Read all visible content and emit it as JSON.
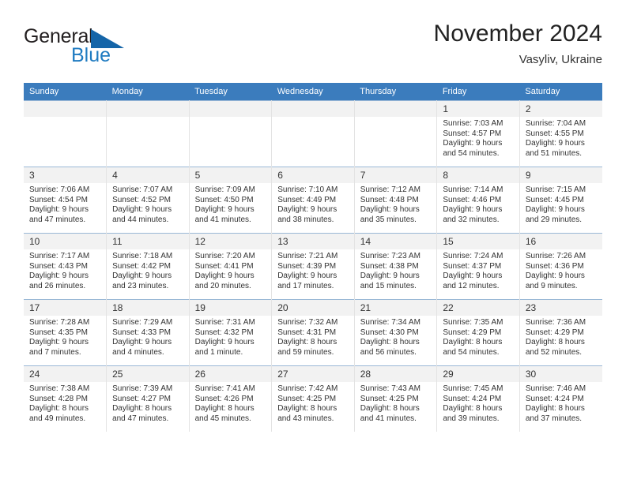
{
  "brand": {
    "name_part1": "General",
    "name_part2": "Blue",
    "logo_icon": "triangle-icon",
    "color_dark": "#231f20",
    "color_blue": "#1f7bc1"
  },
  "header": {
    "title": "November 2024",
    "subtitle": "Vasyliv, Ukraine"
  },
  "calendar": {
    "accent_color": "#3b7cbd",
    "daynum_background": "#f2f2f2",
    "weekday_headers": [
      "Sunday",
      "Monday",
      "Tuesday",
      "Wednesday",
      "Thursday",
      "Friday",
      "Saturday"
    ],
    "weeks": [
      [
        {
          "day": "",
          "empty": true
        },
        {
          "day": "",
          "empty": true
        },
        {
          "day": "",
          "empty": true
        },
        {
          "day": "",
          "empty": true
        },
        {
          "day": "",
          "empty": true
        },
        {
          "day": "1",
          "sunrise": "Sunrise: 7:03 AM",
          "sunset": "Sunset: 4:57 PM",
          "daylight": "Daylight: 9 hours and 54 minutes."
        },
        {
          "day": "2",
          "sunrise": "Sunrise: 7:04 AM",
          "sunset": "Sunset: 4:55 PM",
          "daylight": "Daylight: 9 hours and 51 minutes."
        }
      ],
      [
        {
          "day": "3",
          "sunrise": "Sunrise: 7:06 AM",
          "sunset": "Sunset: 4:54 PM",
          "daylight": "Daylight: 9 hours and 47 minutes."
        },
        {
          "day": "4",
          "sunrise": "Sunrise: 7:07 AM",
          "sunset": "Sunset: 4:52 PM",
          "daylight": "Daylight: 9 hours and 44 minutes."
        },
        {
          "day": "5",
          "sunrise": "Sunrise: 7:09 AM",
          "sunset": "Sunset: 4:50 PM",
          "daylight": "Daylight: 9 hours and 41 minutes."
        },
        {
          "day": "6",
          "sunrise": "Sunrise: 7:10 AM",
          "sunset": "Sunset: 4:49 PM",
          "daylight": "Daylight: 9 hours and 38 minutes."
        },
        {
          "day": "7",
          "sunrise": "Sunrise: 7:12 AM",
          "sunset": "Sunset: 4:48 PM",
          "daylight": "Daylight: 9 hours and 35 minutes."
        },
        {
          "day": "8",
          "sunrise": "Sunrise: 7:14 AM",
          "sunset": "Sunset: 4:46 PM",
          "daylight": "Daylight: 9 hours and 32 minutes."
        },
        {
          "day": "9",
          "sunrise": "Sunrise: 7:15 AM",
          "sunset": "Sunset: 4:45 PM",
          "daylight": "Daylight: 9 hours and 29 minutes."
        }
      ],
      [
        {
          "day": "10",
          "sunrise": "Sunrise: 7:17 AM",
          "sunset": "Sunset: 4:43 PM",
          "daylight": "Daylight: 9 hours and 26 minutes."
        },
        {
          "day": "11",
          "sunrise": "Sunrise: 7:18 AM",
          "sunset": "Sunset: 4:42 PM",
          "daylight": "Daylight: 9 hours and 23 minutes."
        },
        {
          "day": "12",
          "sunrise": "Sunrise: 7:20 AM",
          "sunset": "Sunset: 4:41 PM",
          "daylight": "Daylight: 9 hours and 20 minutes."
        },
        {
          "day": "13",
          "sunrise": "Sunrise: 7:21 AM",
          "sunset": "Sunset: 4:39 PM",
          "daylight": "Daylight: 9 hours and 17 minutes."
        },
        {
          "day": "14",
          "sunrise": "Sunrise: 7:23 AM",
          "sunset": "Sunset: 4:38 PM",
          "daylight": "Daylight: 9 hours and 15 minutes."
        },
        {
          "day": "15",
          "sunrise": "Sunrise: 7:24 AM",
          "sunset": "Sunset: 4:37 PM",
          "daylight": "Daylight: 9 hours and 12 minutes."
        },
        {
          "day": "16",
          "sunrise": "Sunrise: 7:26 AM",
          "sunset": "Sunset: 4:36 PM",
          "daylight": "Daylight: 9 hours and 9 minutes."
        }
      ],
      [
        {
          "day": "17",
          "sunrise": "Sunrise: 7:28 AM",
          "sunset": "Sunset: 4:35 PM",
          "daylight": "Daylight: 9 hours and 7 minutes."
        },
        {
          "day": "18",
          "sunrise": "Sunrise: 7:29 AM",
          "sunset": "Sunset: 4:33 PM",
          "daylight": "Daylight: 9 hours and 4 minutes."
        },
        {
          "day": "19",
          "sunrise": "Sunrise: 7:31 AM",
          "sunset": "Sunset: 4:32 PM",
          "daylight": "Daylight: 9 hours and 1 minute."
        },
        {
          "day": "20",
          "sunrise": "Sunrise: 7:32 AM",
          "sunset": "Sunset: 4:31 PM",
          "daylight": "Daylight: 8 hours and 59 minutes."
        },
        {
          "day": "21",
          "sunrise": "Sunrise: 7:34 AM",
          "sunset": "Sunset: 4:30 PM",
          "daylight": "Daylight: 8 hours and 56 minutes."
        },
        {
          "day": "22",
          "sunrise": "Sunrise: 7:35 AM",
          "sunset": "Sunset: 4:29 PM",
          "daylight": "Daylight: 8 hours and 54 minutes."
        },
        {
          "day": "23",
          "sunrise": "Sunrise: 7:36 AM",
          "sunset": "Sunset: 4:29 PM",
          "daylight": "Daylight: 8 hours and 52 minutes."
        }
      ],
      [
        {
          "day": "24",
          "sunrise": "Sunrise: 7:38 AM",
          "sunset": "Sunset: 4:28 PM",
          "daylight": "Daylight: 8 hours and 49 minutes."
        },
        {
          "day": "25",
          "sunrise": "Sunrise: 7:39 AM",
          "sunset": "Sunset: 4:27 PM",
          "daylight": "Daylight: 8 hours and 47 minutes."
        },
        {
          "day": "26",
          "sunrise": "Sunrise: 7:41 AM",
          "sunset": "Sunset: 4:26 PM",
          "daylight": "Daylight: 8 hours and 45 minutes."
        },
        {
          "day": "27",
          "sunrise": "Sunrise: 7:42 AM",
          "sunset": "Sunset: 4:25 PM",
          "daylight": "Daylight: 8 hours and 43 minutes."
        },
        {
          "day": "28",
          "sunrise": "Sunrise: 7:43 AM",
          "sunset": "Sunset: 4:25 PM",
          "daylight": "Daylight: 8 hours and 41 minutes."
        },
        {
          "day": "29",
          "sunrise": "Sunrise: 7:45 AM",
          "sunset": "Sunset: 4:24 PM",
          "daylight": "Daylight: 8 hours and 39 minutes."
        },
        {
          "day": "30",
          "sunrise": "Sunrise: 7:46 AM",
          "sunset": "Sunset: 4:24 PM",
          "daylight": "Daylight: 8 hours and 37 minutes."
        }
      ]
    ]
  }
}
